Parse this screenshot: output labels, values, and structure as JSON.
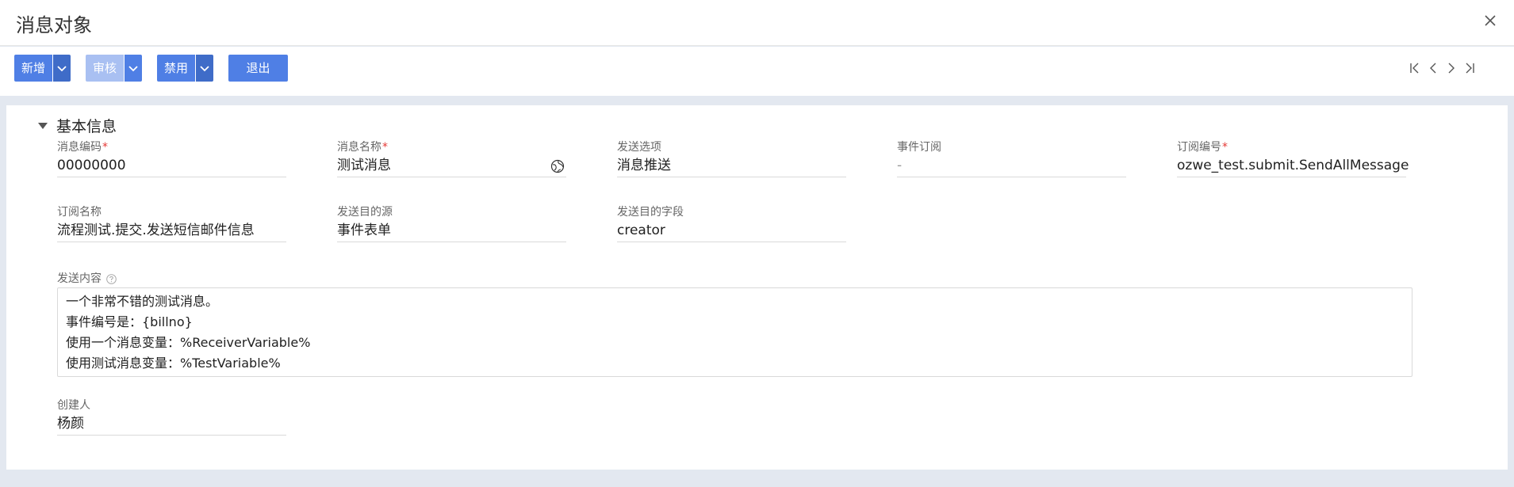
{
  "window": {
    "title": "消息对象"
  },
  "toolbar": {
    "add_label": "新增",
    "audit_label": "审核",
    "disable_label": "禁用",
    "exit_label": "退出"
  },
  "section": {
    "title": "基本信息"
  },
  "fields": {
    "msg_code": {
      "label": "消息编码",
      "required": "*",
      "value": "00000000"
    },
    "msg_name": {
      "label": "消息名称",
      "required": "*",
      "value": "测试消息"
    },
    "send_option": {
      "label": "发送选项",
      "value": "消息推送"
    },
    "event_sub": {
      "label": "事件订阅",
      "value": "-"
    },
    "sub_code": {
      "label": "订阅编号",
      "required": "*",
      "value": "ozwe_test.submit.SendAllMessage"
    },
    "sub_name": {
      "label": "订阅名称",
      "value": "流程测试.提交.发送短信邮件信息"
    },
    "target_source": {
      "label": "发送目的源",
      "value": "事件表单"
    },
    "target_field": {
      "label": "发送目的字段",
      "value": "creator"
    },
    "creator": {
      "label": "创建人",
      "value": "杨颜"
    }
  },
  "content": {
    "label": "发送内容",
    "lines": [
      "一个非常不错的测试消息。",
      "事件编号是：{billno}",
      "使用一个消息变量：%ReceiverVariable%",
      "使用测试消息变量：%TestVariable%"
    ]
  },
  "icons": {
    "close": "close-icon",
    "dropdown": "chevron-down-icon",
    "first": "first-page-icon",
    "prev": "prev-icon",
    "next": "next-icon",
    "last": "last-page-icon",
    "collapse": "triangle-down-icon",
    "globe": "globe-icon",
    "help": "help-icon"
  },
  "colors": {
    "primary": "#4f7fe5",
    "primary_dark": "#3f6cc8",
    "disabled": "#a9c0f2",
    "required": "#e53935",
    "background": "#e3e8f0"
  }
}
